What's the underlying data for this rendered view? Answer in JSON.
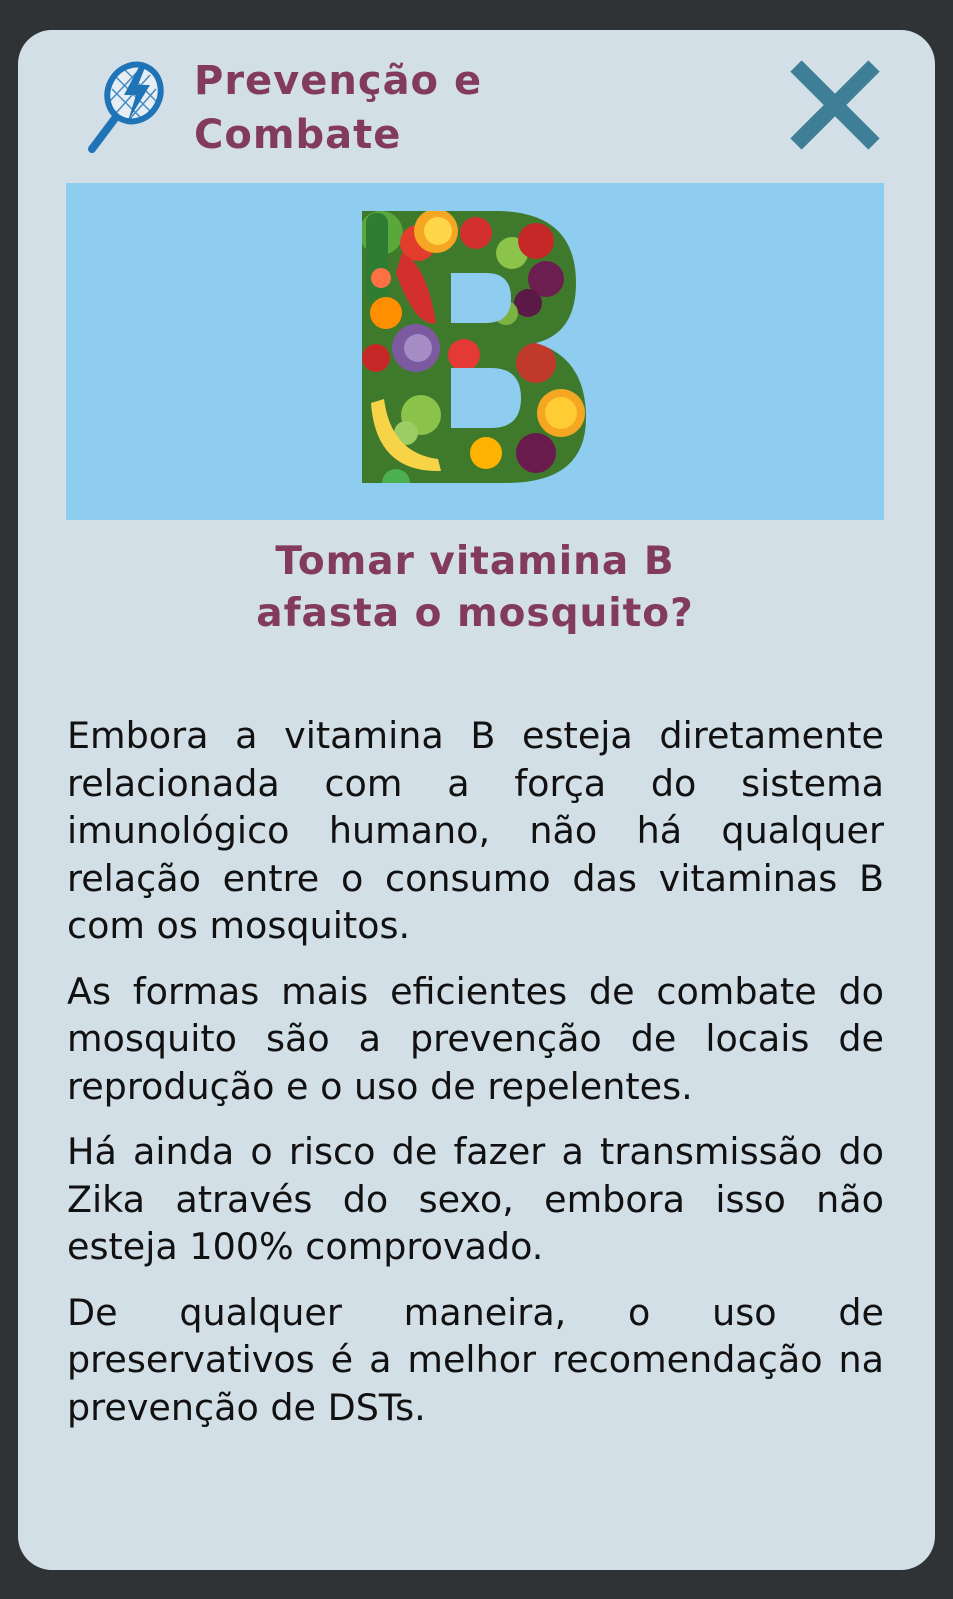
{
  "header": {
    "title_line1": "Prevenção e",
    "title_line2": "Combate",
    "icon": "racket-lightning-icon",
    "close_icon": "close-icon"
  },
  "hero": {
    "letter": "B"
  },
  "article": {
    "question_line1": "Tomar vitamina B",
    "question_line2": "afasta o mosquito?",
    "paragraphs": [
      "Embora a vitamina B esteja diretamente relacionada com a força do sistema imunológico humano, não há qualquer relação entre o consumo das vitaminas B com os mosquitos.",
      "As formas mais eficientes de combate do mosquito são a prevenção de locais de reprodução e o uso de repelentes.",
      "Há ainda o risco de fazer a transmissão do Zika através do sexo, embora isso não esteja 100% comprovado.",
      "De qualquer maneira, o uso de preservativos é a melhor recomendação na prevenção de DSTs."
    ]
  },
  "colors": {
    "background": "#2f3336",
    "card": "#d3dfe7",
    "accent_purple": "#833a5f",
    "close_teal": "#3e7f97",
    "icon_blue": "#1f73b7",
    "hero_blue": "#8ecdf0",
    "text": "#111111"
  }
}
